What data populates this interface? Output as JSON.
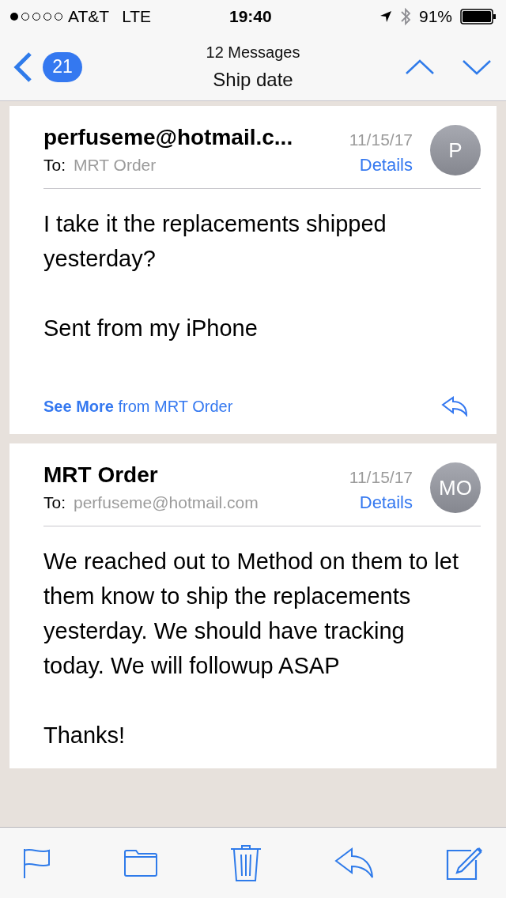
{
  "status_bar": {
    "carrier": "AT&T",
    "network": "LTE",
    "time": "19:40",
    "battery": "91%"
  },
  "nav": {
    "back_count": "21",
    "subtitle": "12 Messages",
    "title": "Ship date"
  },
  "messages": [
    {
      "sender": "perfuseme@hotmail.c...",
      "date": "11/15/17",
      "to_label": "To:",
      "to": "MRT Order",
      "details": "Details",
      "avatar": "P",
      "body": "I take it the replacements shipped yesterday?\n\nSent from my iPhone",
      "see_more": "**See More** from MRT Order"
    },
    {
      "sender": "MRT Order",
      "date": "11/15/17",
      "to_label": "To:",
      "to": "perfuseme@hotmail.com",
      "details": "Details",
      "avatar": "MO",
      "body": "We reached out to Method on them to let them know to ship the replacements yesterday. We should have tracking today. We will followup ASAP\n\nThanks!"
    }
  ]
}
